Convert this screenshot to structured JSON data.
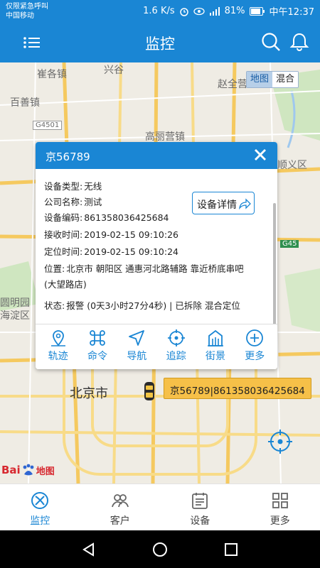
{
  "status_bar": {
    "carrier_line1": "仅限紧急呼叫",
    "carrier_line2": "中国移动",
    "speed": "1.6 K/s",
    "battery": "81%",
    "time": "中午12:37"
  },
  "header": {
    "title": "监控"
  },
  "map": {
    "toggle": {
      "map_label": "地图",
      "hybrid_label": "混合"
    },
    "labels": {
      "cuigezhuang": "崔各镇",
      "xingu": "兴谷",
      "baishan": "百善镇",
      "zhaoquanying": "赵全营",
      "g4501": "G4501",
      "gaoliying": "高丽营镇",
      "shunyi": "顺义区",
      "g45": "G45",
      "yuanmingyuan": "圆明园",
      "haidian": "海淀区",
      "beijing": "北京市"
    },
    "baidu_left": "Bai",
    "baidu_right": "地图"
  },
  "popup": {
    "plate": "京56789",
    "detail_button": "设备详情",
    "fields": [
      {
        "label": "设备类型:",
        "value": "无线"
      },
      {
        "label": "公司名称:",
        "value": "测试"
      },
      {
        "label": "设备编码:",
        "value": "861358036425684"
      },
      {
        "label": "接收时间:",
        "value": "2019-02-15 09:10:26"
      },
      {
        "label": "定位时间:",
        "value": "2019-02-15 09:10:24"
      }
    ],
    "address_label": "位置:",
    "address_value": "北京市 朝阳区 通惠河北路辅路 靠近桥底串吧(大望路店)",
    "status_label": "状态:",
    "status_value": "报警 (0天3小时27分4秒) | 已拆除 混合定位",
    "actions": [
      "轨迹",
      "命令",
      "导航",
      "追踪",
      "街景",
      "更多"
    ]
  },
  "vehicle_marker": {
    "label": "京56789|861358036425684"
  },
  "bottom_nav": [
    {
      "label": "监控",
      "icon": "monitor-icon",
      "active": true
    },
    {
      "label": "客户",
      "icon": "customer-icon",
      "active": false
    },
    {
      "label": "设备",
      "icon": "device-icon",
      "active": false
    },
    {
      "label": "更多",
      "icon": "more-grid-icon",
      "active": false
    }
  ],
  "colors": {
    "primary": "#1a86d4",
    "marker_label_bg": "#f6c048",
    "map_bg": "#efece4",
    "road_major": "#f9d97a"
  }
}
